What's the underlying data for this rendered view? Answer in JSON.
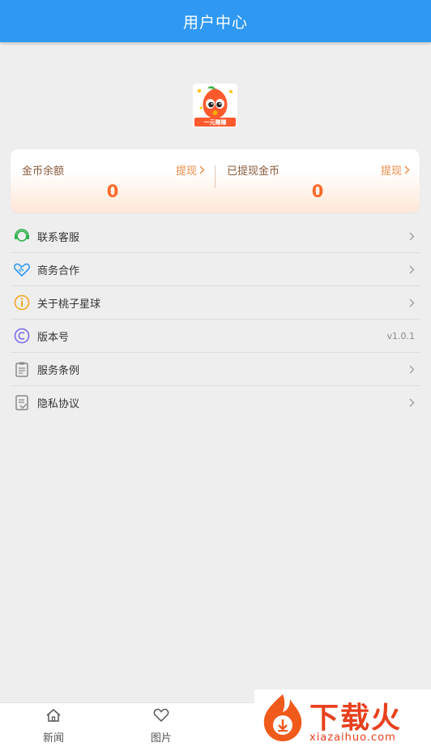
{
  "header": {
    "title": "用户中心"
  },
  "avatar": {
    "badge_text": "一元赚赚"
  },
  "coins": {
    "balance_label": "金币余额",
    "balance_action": "提现",
    "balance_value": "0",
    "withdrawn_label": "已提现金币",
    "withdrawn_action": "提现",
    "withdrawn_value": "0"
  },
  "menu": {
    "items": [
      {
        "label": "联系客服",
        "icon": "customer-service-icon"
      },
      {
        "label": "商务合作",
        "icon": "handshake-icon"
      },
      {
        "label": "关于桃子星球",
        "icon": "info-icon"
      },
      {
        "label": "版本号",
        "icon": "copyright-icon",
        "value": "v1.0.1"
      },
      {
        "label": "服务条例",
        "icon": "clipboard-icon"
      },
      {
        "label": "隐私协议",
        "icon": "document-icon"
      }
    ]
  },
  "tabbar": {
    "items": [
      {
        "label": "新闻",
        "icon": "home-icon"
      },
      {
        "label": "图片",
        "icon": "heart-icon"
      }
    ]
  },
  "watermark": {
    "text": "下载火",
    "url": "xiazaihuo.com"
  },
  "colors": {
    "header": "#2f98f3",
    "accent": "#ff6a2a",
    "background": "#eeeeee"
  }
}
